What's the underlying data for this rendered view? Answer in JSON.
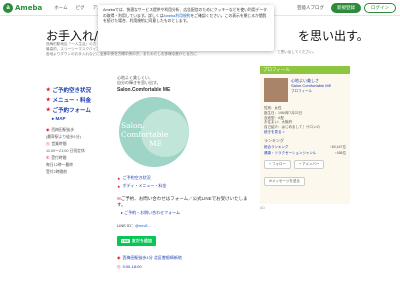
{
  "header": {
    "logo_badge": "a",
    "logo_text": "Ameba",
    "nav": [
      "ホーム",
      "ピグ",
      "アメブロ"
    ],
    "right_link": "芸能人ブログ",
    "register": "新規登録",
    "login": "ログイン"
  },
  "title_left": "お手入れ/眉脱",
  "title_right": "を思い出す。",
  "subtitle": "西梅田駅地区「一人生活」の方",
  "subtitle_line2": "最高的、スリーツーマスクパイプ(松)で行っています★",
  "subtitle_line3": "各地よりダウンのお手入れなどに全身中央を方眼中央の方、またわたしお多様な受けとる方に",
  "subtitle_right": "て思い出してください。",
  "modal": {
    "text_before": "Amebaでは、快適なサービス提供や利用分析、広告配信のためにクッキーなどを使い利用データの取得・利用しています。詳しくは",
    "link": "Ameba利用規約",
    "text_after": "をご確認ください。この表示を閉じるか閲覧を続けた場合、利用規約に同意したものとします。"
  },
  "left_menu": {
    "items": [
      "ご予約空き状況",
      "メニュー・料金",
      "ご予約フォーム"
    ],
    "map": "MAP",
    "info": [
      "西梅田駅徒歩",
      "(最寄駅より徒歩1分)",
      "営業時間",
      "11:00〜21:00 日祝定休",
      "受付時間",
      "毎日12時〜最終",
      "受付2時間前"
    ]
  },
  "middle": {
    "intro_line1": "心地よく美しくい、",
    "intro_line2": "自分の輝きを思い出す。",
    "salon_name": "Salon.Comfortable ME",
    "logo_line1": "Salon.",
    "logo_line2": "Comfortable",
    "logo_line3": "ME",
    "links": [
      "ご予約空き状況",
      "ボディ・メニュー・料金"
    ],
    "contact_heading": "ご予約、お問い合わせはフォーム／公式LINEでお受けいたします。",
    "contact_sub": "ご予約・お問い合わせフォーム",
    "line_label": "LINE ID：",
    "line_value": "@ecv8...",
    "line_btn": "友だち追加",
    "line_icon": "LINE",
    "address": "西梅田駅徒歩1分 北区曽根崎新地",
    "hours": "9:00-18:00"
  },
  "profile": {
    "header": "プロフィール",
    "name_line1": "心地よい美しさ",
    "name_line2": "Salon.Comfortable ME",
    "edit": "プロフィール",
    "meta": [
      "性別：女性",
      "誕生日：1984年7月22日",
      "血液型：A型",
      "お住まい：大阪府",
      "自己紹介：はじめまして！サロンの"
    ],
    "meta_more": "続きを見る >",
    "ranking_title": "ランキング",
    "rankings": [
      {
        "label": "総合ランキング",
        "value": "80,447位"
      },
      {
        "label": "健康・リラクゼーションジャンル",
        "value": "458位"
      }
    ],
    "follow": "フォロー",
    "reader": "アメンバー",
    "message": "メッセージを送る"
  },
  "ad_label": "AD"
}
